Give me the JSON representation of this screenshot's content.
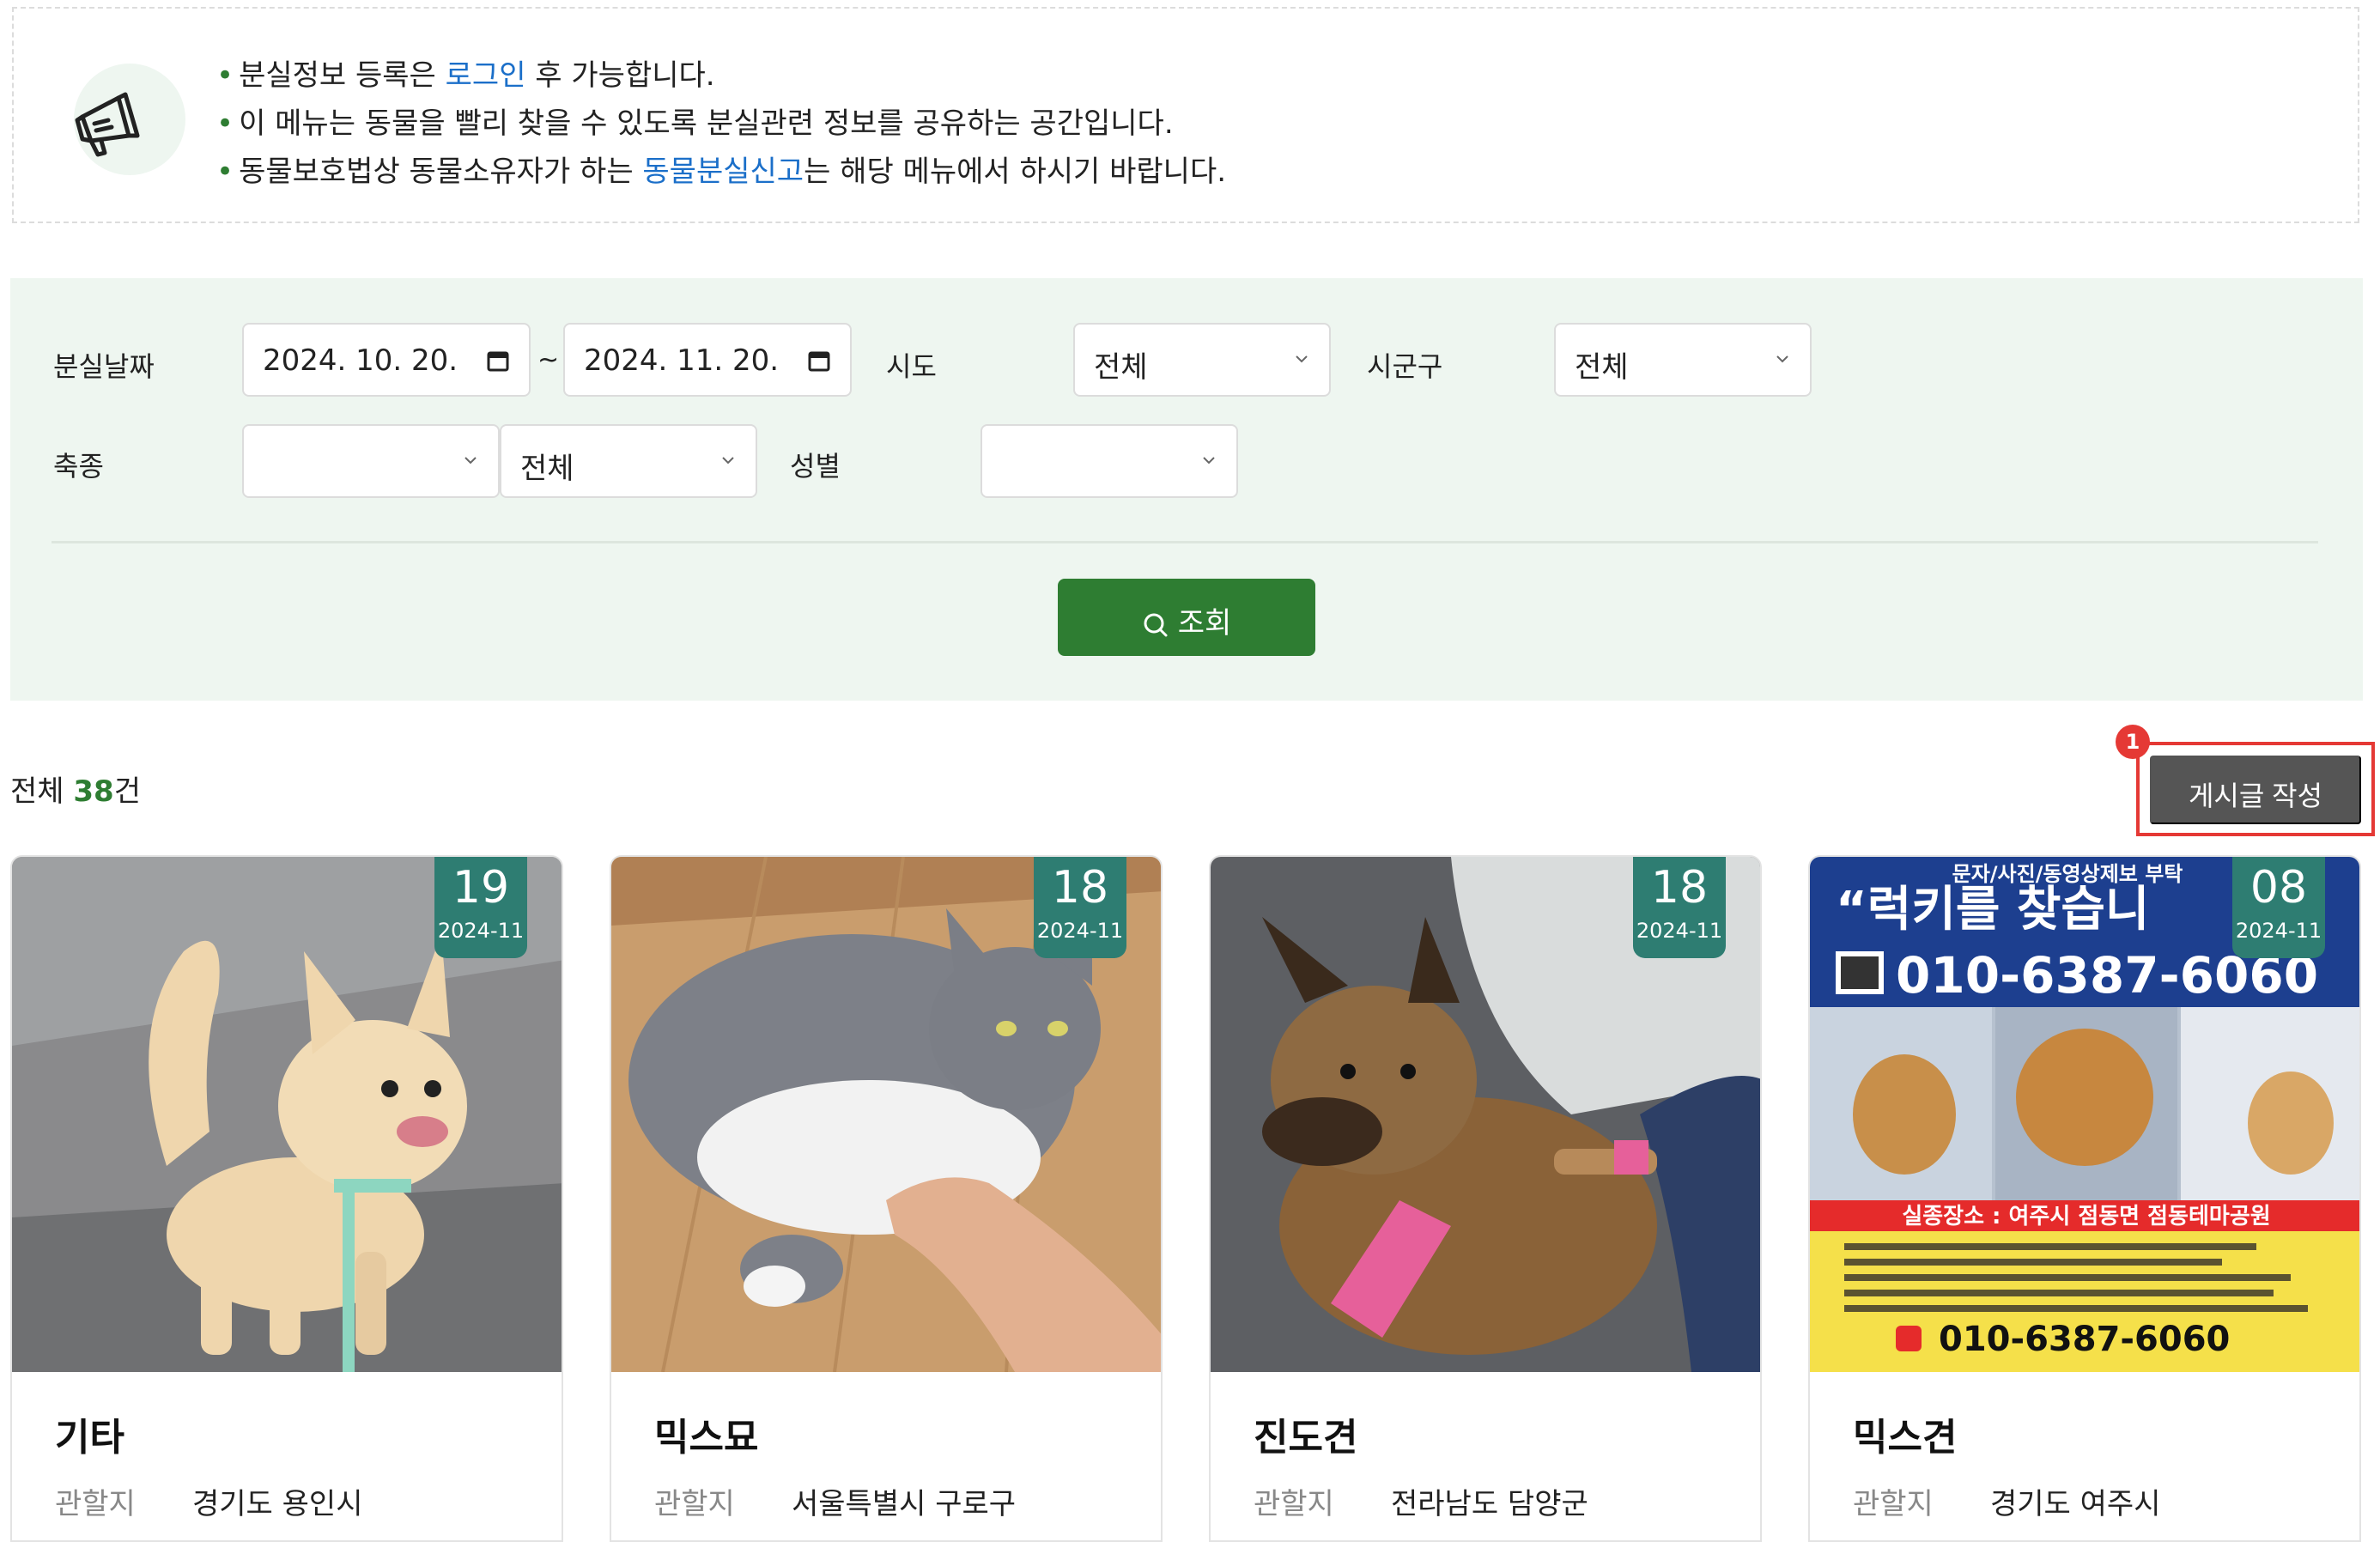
{
  "notice": {
    "icon": "megaphone-icon",
    "line1": {
      "pre": "분실정보 등록은 ",
      "link": "로그인",
      "post": " 후 가능합니다."
    },
    "line2": {
      "text": "이 메뉴는 동물을 빨리 찾을 수 있도록 분실관련 정보를 공유하는 공간입니다."
    },
    "line3": {
      "pre": "동물보호법상 동물소유자가 하는 ",
      "link": "동물분실신고",
      "post": "는 해당 메뉴에서 하시기 바랍니다."
    }
  },
  "filter": {
    "lost_date_label": "분실날짜",
    "date_from": "2024. 10. 20.",
    "date_to": "2024. 11. 20.",
    "tilde": "~",
    "sido_label": "시도",
    "sido_value": "전체",
    "sigungu_label": "시군구",
    "sigungu_value": "전체",
    "species_label": "축종",
    "species_value": "",
    "breed_value": "전체",
    "sex_label": "성별",
    "sex_value": "",
    "search_button": "조회"
  },
  "results": {
    "total_prefix": "전체 ",
    "total_count": "38",
    "total_suffix": "건",
    "write_button": "게시글 작성",
    "annotation_badge": "1"
  },
  "cards": [
    {
      "day": "19",
      "ym": "2024-11",
      "breed": "기타",
      "jurisdiction_label": "관할지",
      "jurisdiction": "경기도 용인시"
    },
    {
      "day": "18",
      "ym": "2024-11",
      "breed": "믹스묘",
      "jurisdiction_label": "관할지",
      "jurisdiction": "서울특별시 구로구"
    },
    {
      "day": "18",
      "ym": "2024-11",
      "breed": "진도견",
      "jurisdiction_label": "관할지",
      "jurisdiction": "전라남도 담양군"
    },
    {
      "day": "08",
      "ym": "2024-11",
      "breed": "믹스견",
      "jurisdiction_label": "관할지",
      "jurisdiction": "경기도 여주시",
      "poster": {
        "top": "문자/사진/동영상제보 부탁",
        "headline": "“럭키를 찾습니",
        "phone": "010-6387-6060",
        "place": "실종장소 : 여주시 점동면 점동테마공원"
      }
    }
  ]
}
